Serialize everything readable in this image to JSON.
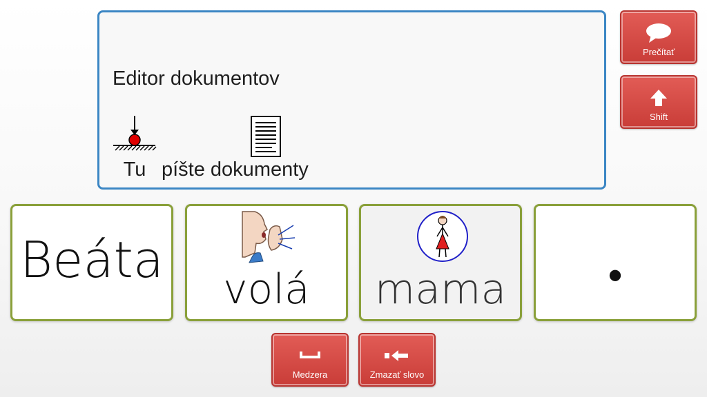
{
  "document": {
    "title": "Editor dokumentov",
    "symbols": [
      {
        "label": "Tu",
        "icon": "here-arrow-icon"
      },
      {
        "label": "píšte dokumenty",
        "icon": "document-icon"
      }
    ]
  },
  "actions": {
    "read": {
      "label": "Prečítať",
      "icon": "speech-bubble-icon"
    },
    "shift": {
      "label": "Shift",
      "icon": "up-arrow-icon"
    },
    "space": {
      "label": "Medzera",
      "icon": "space-bar-icon"
    },
    "delete_word": {
      "label": "Zmazať slovo",
      "icon": "backspace-arrow-icon"
    }
  },
  "words": [
    {
      "text": "Beáta",
      "icon": null
    },
    {
      "text": "volá",
      "icon": "calling-person-icon"
    },
    {
      "text": "mama",
      "icon": "mother-figure-icon"
    },
    {
      "text": "•",
      "icon": null
    }
  ],
  "colors": {
    "panel_border": "#3b86c4",
    "action_button": "#d44a45",
    "word_card_border": "#8aa03a"
  }
}
